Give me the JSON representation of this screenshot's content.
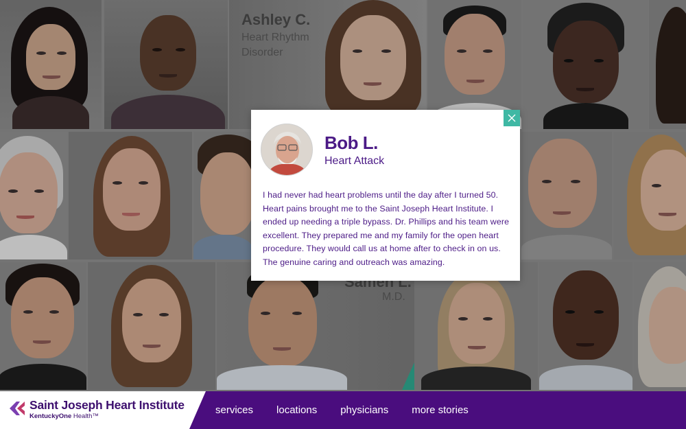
{
  "grid": {
    "stories": [
      {
        "name": "Ashley C.",
        "subtitle_lines": [
          "Heart Rhythm",
          "Disorder"
        ]
      },
      {
        "name": "Sameh L.",
        "subtitle_lines": [
          "M.D."
        ]
      }
    ]
  },
  "modal": {
    "name": "Bob L.",
    "condition": "Heart Attack",
    "quote": "I had never had heart problems until the day after I turned 50. Heart pains brought me to the Saint Joseph Heart Institute. I ended up needing a triple bypass. Dr. Phillips and his team were excellent. They prepared me and my family for the open heart procedure. They would call us at home after to check in on us. The genuine caring and outreach was amazing.",
    "close_icon": "close-icon",
    "accent_color": "#4b1a86",
    "close_color": "#3fb8a4"
  },
  "footer": {
    "brand_title": "Saint Joseph Heart Institute",
    "brand_sub_bold": "KentuckyOne",
    "brand_sub_rest": " Health™",
    "nav": [
      "services",
      "locations",
      "physicians",
      "more stories"
    ],
    "bar_color": "#4a0d7e"
  }
}
